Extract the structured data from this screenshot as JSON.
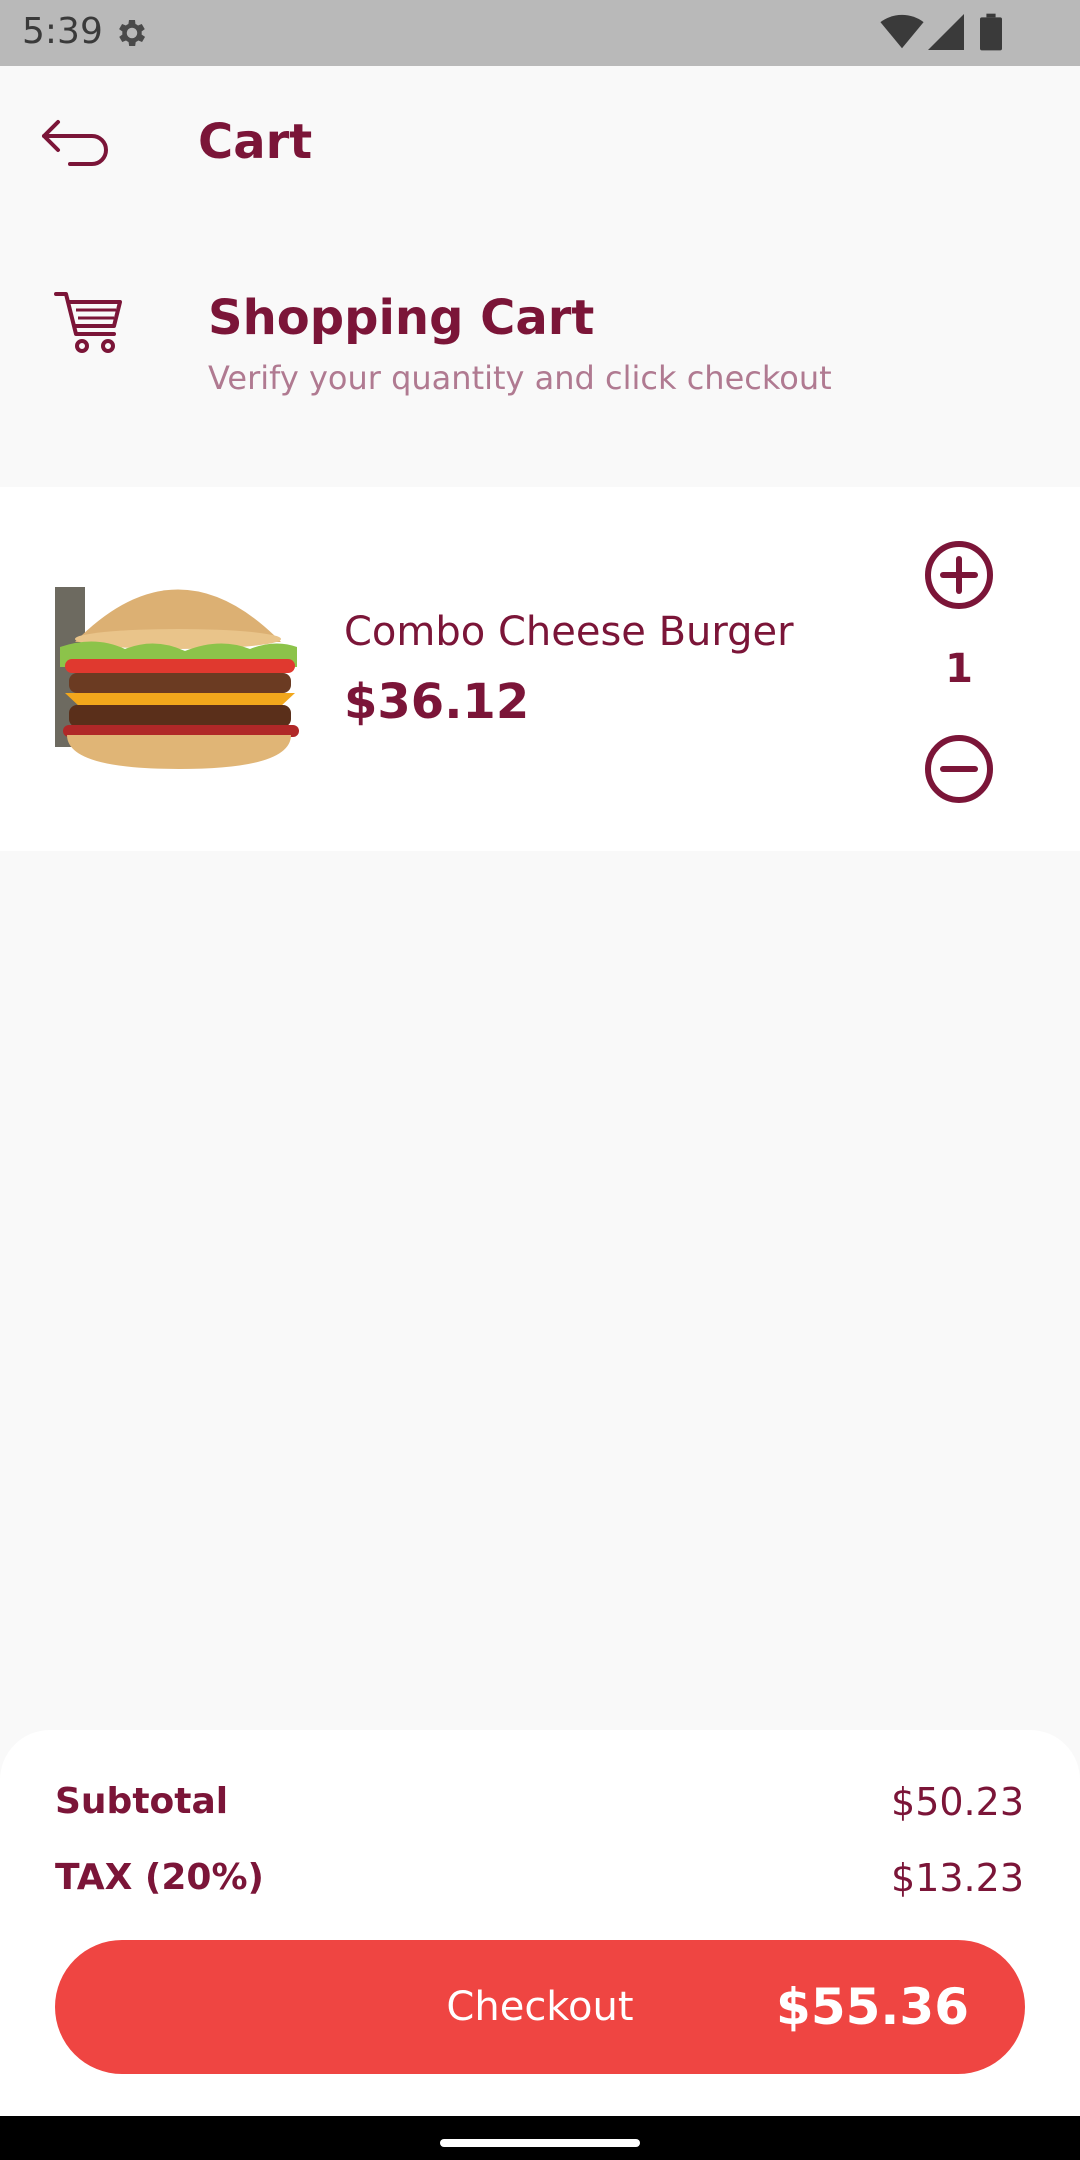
{
  "status_bar": {
    "time": "5:39",
    "icons": [
      "gear-icon",
      "wifi-icon",
      "signal-icon",
      "battery-icon"
    ]
  },
  "header": {
    "title": "Cart",
    "back_icon": "back-arrow-icon"
  },
  "cart_header": {
    "icon": "shopping-cart-icon",
    "title": "Shopping Cart",
    "subtitle": "Verify your quantity and click checkout"
  },
  "items": [
    {
      "name": "Combo Cheese Burger",
      "price": "$36.12",
      "quantity": "1",
      "image": "burger-image"
    }
  ],
  "summary": {
    "subtotal_label": "Subtotal",
    "subtotal_value": "$50.23",
    "tax_label": "TAX (20%)",
    "tax_value": "$13.23",
    "checkout_label": "Checkout",
    "checkout_total": "$55.36"
  },
  "colors": {
    "brand": "#7b1538",
    "accent": "#ef4542",
    "subtitle": "#b07a91",
    "background": "#f9f9f9"
  }
}
